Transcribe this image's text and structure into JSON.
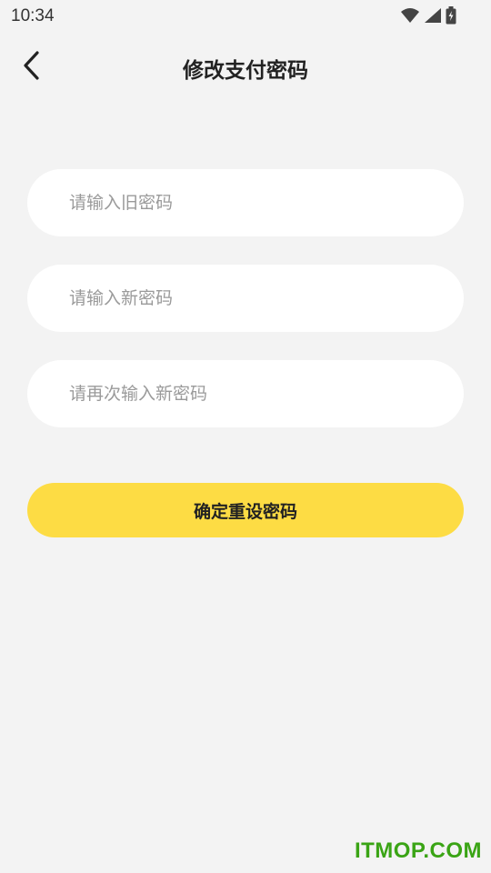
{
  "status_bar": {
    "time": "10:34",
    "icons": [
      "wifi-icon",
      "signal-icon",
      "battery-icon"
    ]
  },
  "nav": {
    "back_icon": "chevron-left-icon",
    "title": "修改支付密码"
  },
  "form": {
    "old_password_placeholder": "请输入旧密码",
    "new_password_placeholder": "请输入新密码",
    "confirm_password_placeholder": "请再次输入新密码",
    "submit_label": "确定重设密码"
  },
  "watermark": "ITMOP.COM",
  "colors": {
    "background": "#f3f3f3",
    "accent": "#fddc44",
    "field_bg": "#ffffff",
    "placeholder": "#9a9a9a",
    "watermark": "#3aa415"
  }
}
